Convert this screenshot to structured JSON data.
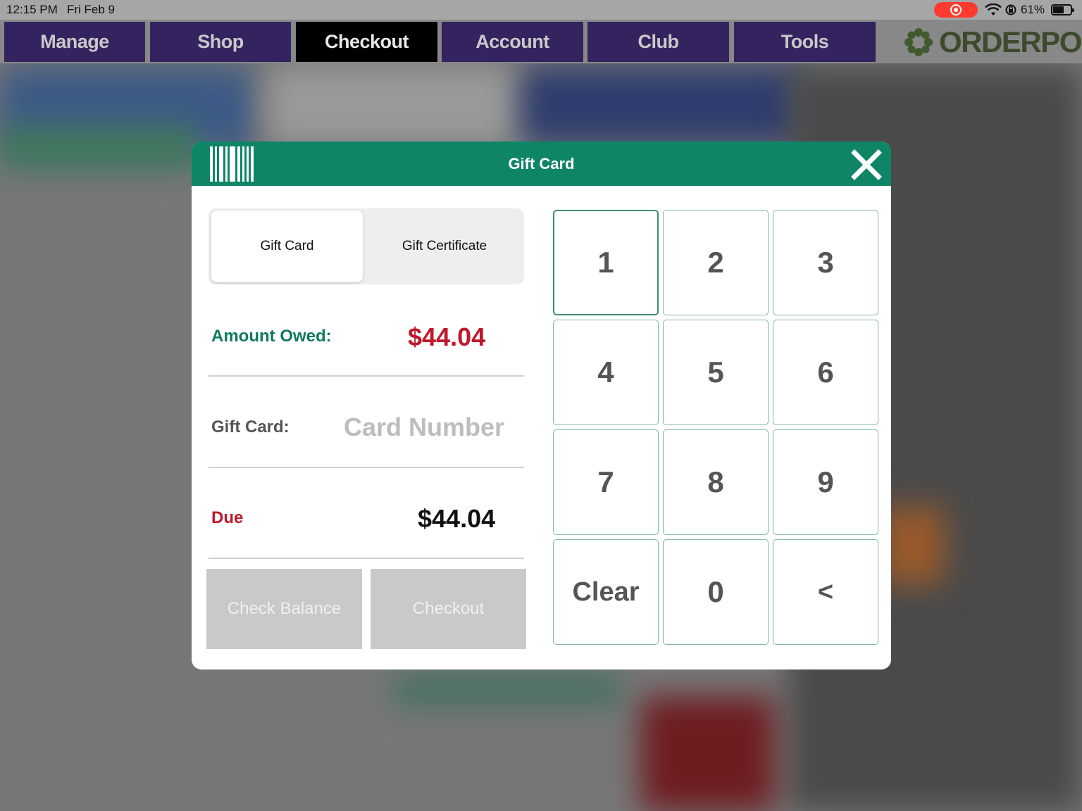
{
  "status_bar": {
    "time": "12:15 PM",
    "date": "Fri Feb 9",
    "battery_percent": "61%",
    "battery_level": 0.61
  },
  "nav": {
    "tabs": [
      {
        "label": "Manage",
        "active": false
      },
      {
        "label": "Shop",
        "active": false
      },
      {
        "label": "Checkout",
        "active": true
      },
      {
        "label": "Account",
        "active": false
      },
      {
        "label": "Club",
        "active": false
      },
      {
        "label": "Tools",
        "active": false
      }
    ],
    "brand": "ORDERPORT"
  },
  "modal": {
    "title": "Gift Card",
    "segments": {
      "selected": "Gift Card",
      "other": "Gift Certificate"
    },
    "amount_owed_label": "Amount Owed:",
    "amount_owed_value": "$44.04",
    "gift_card_label": "Gift Card:",
    "card_number_placeholder": "Card Number",
    "due_label": "Due",
    "due_value": "$44.04",
    "check_balance_label": "Check Balance",
    "checkout_label": "Checkout",
    "keypad": [
      "1",
      "2",
      "3",
      "4",
      "5",
      "6",
      "7",
      "8",
      "9",
      "Clear",
      "0",
      "<"
    ]
  },
  "colors": {
    "nav_tab": "#35235f",
    "nav_active": "#000000",
    "modal_header": "#0e8567",
    "amount_owed_label": "#0e7a5e",
    "amount_value": "#c0182b",
    "disabled_button": "#c9c9c9",
    "key_border": "#7fb8a4"
  }
}
